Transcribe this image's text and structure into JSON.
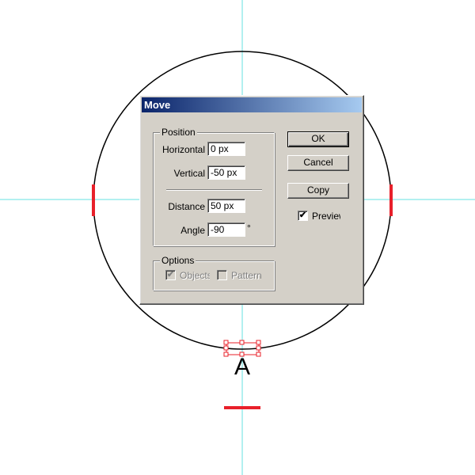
{
  "artwork": {
    "anchor_label": "A",
    "guide_color": "#66e0e0",
    "mark_color": "#e8202a",
    "circle_color": "#000000"
  },
  "dialog": {
    "title": "Move",
    "position_group": {
      "legend": "Position",
      "horizontal_label": "Horizontal",
      "horizontal_value": "0 px",
      "vertical_label": "Vertical",
      "vertical_value": "-50 px",
      "distance_label": "Distance",
      "distance_value": "50 px",
      "angle_label": "Angle",
      "angle_value": "-90",
      "angle_unit": "°"
    },
    "options_group": {
      "legend": "Options",
      "objects_label": "Objects",
      "objects_checked": true,
      "patterns_label": "Patterns",
      "patterns_checked": false
    },
    "buttons": {
      "ok": "OK",
      "cancel": "Cancel",
      "copy": "Copy"
    },
    "preview": {
      "label": "Preview",
      "checked": true,
      "check_glyph": "✔"
    }
  }
}
